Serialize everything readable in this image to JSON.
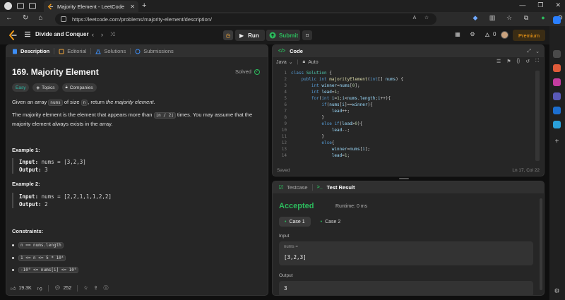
{
  "browser": {
    "tab_title": "Majority Element - LeetCode",
    "url": "https://leetcode.com/problems/majority-element/description/"
  },
  "header": {
    "problem_list": "Divide and Conquer",
    "run_label": "Run",
    "submit_label": "Submit",
    "streak": "0",
    "premium_label": "Premium"
  },
  "description": {
    "tabs": [
      "Description",
      "Editorial",
      "Solutions",
      "Submissions"
    ],
    "title": "169. Majority Element",
    "status": "Solved",
    "tags": {
      "difficulty": "Easy",
      "topics": "Topics",
      "companies": "Companies"
    },
    "para1": {
      "prefix": "Given an array ",
      "code1": "nums",
      "mid": " of size ",
      "code2": "n",
      "suffix": ", return ",
      "emph": "the majority element",
      "end": "."
    },
    "para2": {
      "prefix": "The majority element is the element that appears more than ",
      "code": "⌊n / 2⌋",
      "suffix": " times. You may assume that the majority element always exists in the array."
    },
    "examples": [
      {
        "heading": "Example 1:",
        "input_label": "Input:",
        "input": "nums = [3,2,3]",
        "output_label": "Output:",
        "output": "3"
      },
      {
        "heading": "Example 2:",
        "input_label": "Input:",
        "input": "nums = [2,2,1,1,1,2,2]",
        "output_label": "Output:",
        "output": "2"
      }
    ],
    "constraints_heading": "Constraints:",
    "constraints": [
      "n == nums.length",
      "1 <= n <= 5 * 10⁴",
      "-10⁹ <= nums[i] <= 10⁹"
    ],
    "footer": {
      "likes": "19.3K",
      "comments": "252"
    }
  },
  "code": {
    "tab": "Code",
    "language": "Java",
    "mode": "Auto",
    "lines": [
      {
        "n": "1",
        "html": "<span class='kw'>class</span> <span class='ty'>Solution</span> <span class='pn'>{</span>"
      },
      {
        "n": "2",
        "html": "    <span class='kw'>public</span> <span class='kw'>int</span> <span class='fn'>majorityElement</span><span class='pn'>(</span><span class='kw'>int</span><span class='pn'>[]</span> <span class='vr'>nums</span><span class='pn'>) {</span>"
      },
      {
        "n": "3",
        "html": "        <span class='kw'>int</span> <span class='vr'>winner</span><span class='pn'>=</span><span class='vr'>nums</span><span class='pn'>[</span><span class='nm'>0</span><span class='pn'>];</span>"
      },
      {
        "n": "4",
        "html": "        <span class='kw'>int</span> <span class='vr'>lead</span><span class='pn'>=</span><span class='nm'>1</span><span class='pn'>;</span>"
      },
      {
        "n": "5",
        "html": "        <span class='kw'>for</span><span class='pn'>(</span><span class='kw'>int</span> <span class='vr'>i</span><span class='pn'>=</span><span class='nm'>1</span><span class='pn'>;</span><span class='vr'>i</span><span class='pn'>&lt;</span><span class='vr'>nums</span><span class='pn'>.</span><span class='vr'>length</span><span class='pn'>;</span><span class='vr'>i</span><span class='pn'>++){</span>"
      },
      {
        "n": "6",
        "html": "            <span class='kw'>if</span><span class='pn'>(</span><span class='vr'>nums</span><span class='pn'>[</span><span class='vr'>i</span><span class='pn'>]==</span><span class='vr'>winner</span><span class='pn'>){</span>"
      },
      {
        "n": "7",
        "html": "                <span class='vr'>lead</span><span class='pn'>++;</span>"
      },
      {
        "n": "8",
        "html": "            <span class='pn'>}</span>"
      },
      {
        "n": "9",
        "html": "            <span class='kw'>else</span> <span class='kw'>if</span><span class='pn'>(</span><span class='vr'>lead</span><span class='pn'>&gt;</span><span class='nm'>0</span><span class='pn'>){</span>"
      },
      {
        "n": "10",
        "html": "                <span class='vr'>lead</span><span class='pn'>--;</span>"
      },
      {
        "n": "11",
        "html": "            <span class='pn'>}</span>"
      },
      {
        "n": "12",
        "html": "            <span class='kw'>else</span><span class='pn'>{</span>"
      },
      {
        "n": "13",
        "html": "                <span class='vr'>winner</span><span class='pn'>=</span><span class='vr'>nums</span><span class='pn'>[</span><span class='vr'>i</span><span class='pn'>];</span>"
      },
      {
        "n": "14",
        "html": "                <span class='vr'>lead</span><span class='pn'>=</span><span class='nm'>1</span><span class='pn'>;</span>"
      }
    ],
    "saved": "Saved",
    "cursor": "Ln 17, Col 22"
  },
  "test": {
    "tabs": [
      "Testcase",
      "Test Result"
    ],
    "status": "Accepted",
    "runtime": "Runtime: 0 ms",
    "cases": [
      "Case 1",
      "Case 2"
    ],
    "input_label": "Input",
    "input_key": "nums =",
    "input_value": "[3,2,3]",
    "output_label": "Output",
    "output_value": "3"
  }
}
